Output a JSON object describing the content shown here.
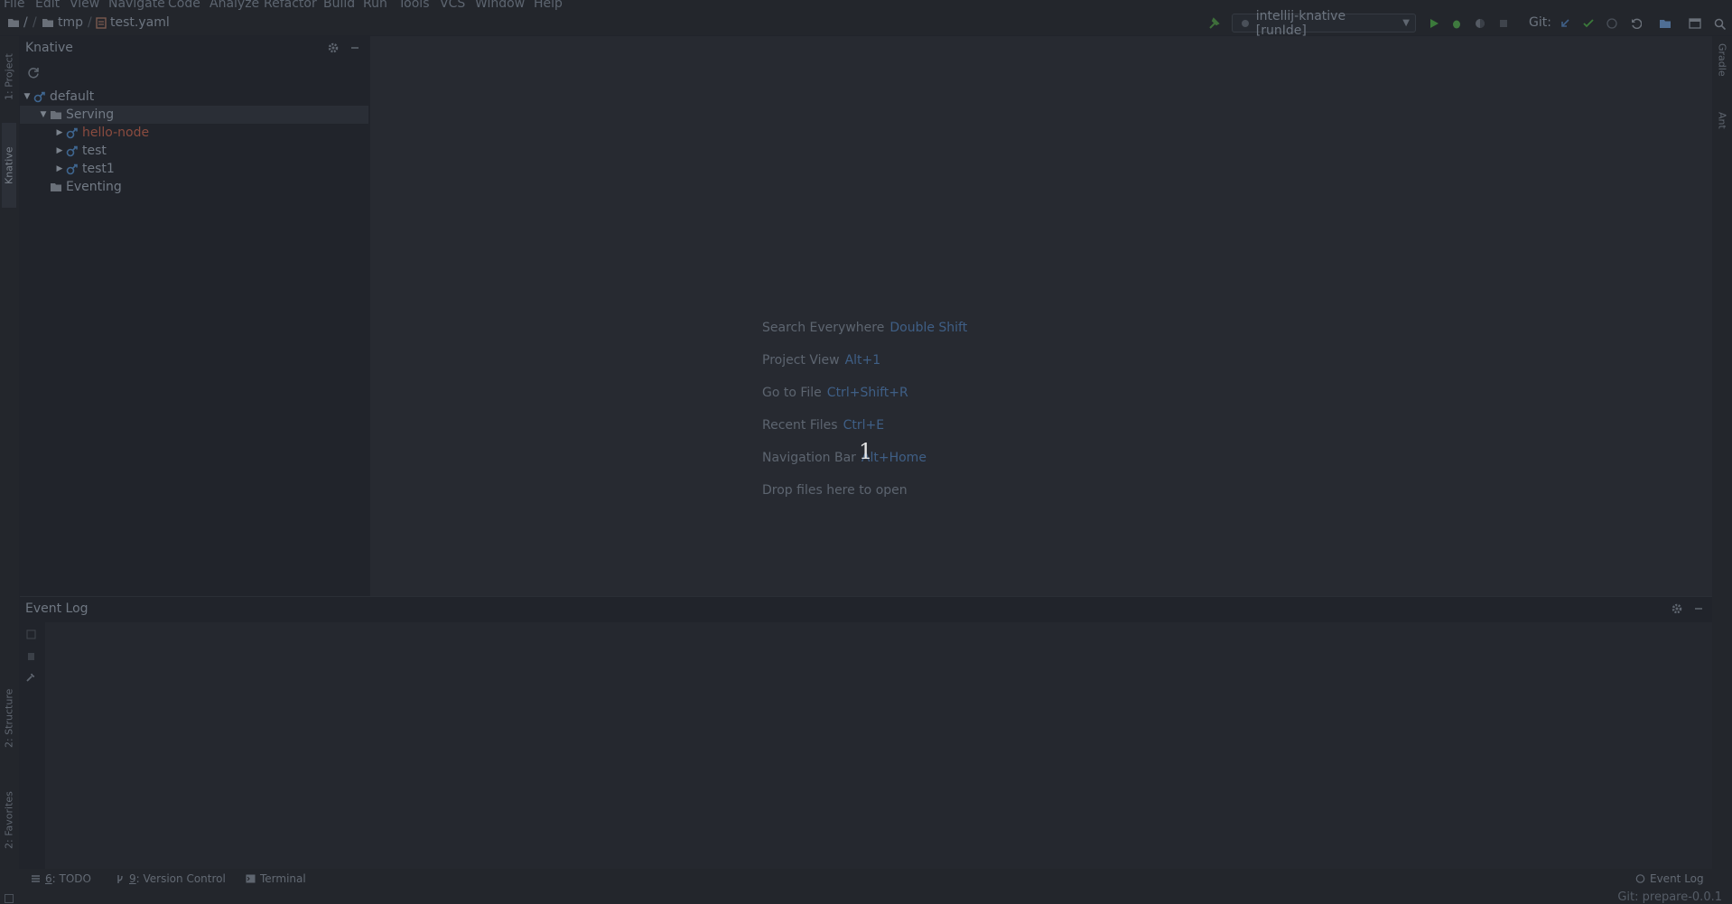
{
  "menu": [
    "File",
    "Edit",
    "View",
    "Navigate",
    "Code",
    "Analyze",
    "Refactor",
    "Build",
    "Run",
    "Tools",
    "VCS",
    "Window",
    "Help"
  ],
  "breadcrumb": {
    "root": "/",
    "folder": "tmp",
    "file": "test.yaml"
  },
  "toolbar": {
    "run_config": "intellij-knative [runIde]",
    "git_label": "Git:"
  },
  "left_stripe": {
    "project_tab": "1: Project",
    "knative_tab": "Knative",
    "structure_tab": "2: Structure",
    "favorites_tab": "2: Favorites"
  },
  "right_stripe": {
    "gradle_tab": "Gradle",
    "ant_tab": "Ant"
  },
  "knative_panel": {
    "title": "Knative",
    "tree": {
      "namespace": "default",
      "serving": "Serving",
      "services": [
        "hello-node",
        "test",
        "test1"
      ],
      "eventing": "Eventing"
    }
  },
  "editor": {
    "hints": [
      {
        "label": "Search Everywhere",
        "key": "Double Shift"
      },
      {
        "label": "Project View",
        "key": "Alt+1"
      },
      {
        "label": "Go to File",
        "key": "Ctrl+Shift+R"
      },
      {
        "label": "Recent Files",
        "key": "Ctrl+E"
      },
      {
        "label": "Navigation Bar",
        "key": "Alt+Home"
      },
      {
        "label": "Drop files here to open",
        "key": ""
      }
    ],
    "step_marker": "1"
  },
  "event_log_panel": {
    "title": "Event Log"
  },
  "bottom_tabs": {
    "todo_num": "6",
    "todo": ": TODO",
    "vc_num": "9",
    "vc": ": Version Control",
    "terminal": "Terminal",
    "event_log": "Event Log"
  },
  "status": {
    "git_branch": "Git: prepare-0.0.1"
  },
  "colors": {
    "background": "#21242b",
    "editor_background": "#272a31",
    "shortcut_key": "#3f5f86",
    "error_service": "#8a4b3f",
    "run_green": "#3b7a3b"
  }
}
